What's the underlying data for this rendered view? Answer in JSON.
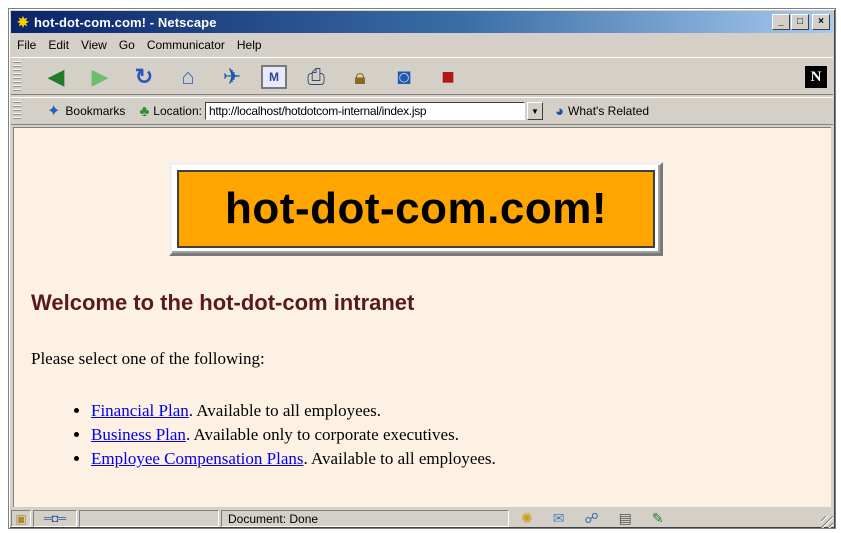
{
  "window": {
    "title": "hot-dot-com.com! - Netscape",
    "icon": "netscape-app-icon",
    "controls": [
      "_",
      "□",
      "×"
    ]
  },
  "menubar": {
    "items": [
      "File",
      "Edit",
      "View",
      "Go",
      "Communicator",
      "Help"
    ]
  },
  "nav_toolbar": {
    "buttons": [
      {
        "name": "back",
        "icon": "back-arrow-icon"
      },
      {
        "name": "forward",
        "icon": "forward-arrow-icon"
      },
      {
        "name": "reload",
        "icon": "reload-icon"
      },
      {
        "name": "home",
        "icon": "home-icon"
      },
      {
        "name": "search",
        "icon": "search-icon"
      },
      {
        "name": "netscape-guide",
        "icon": "guide-icon"
      },
      {
        "name": "print",
        "icon": "print-icon"
      },
      {
        "name": "security",
        "icon": "lock-icon"
      },
      {
        "name": "shop",
        "icon": "shopping-bag-icon"
      },
      {
        "name": "stop",
        "icon": "stop-icon"
      }
    ],
    "logo": "N"
  },
  "location_toolbar": {
    "bookmarks_label": "Bookmarks",
    "location_label": "Location:",
    "url": "http://localhost/hotdotcom-internal/index.jsp",
    "related_label": "What's Related"
  },
  "page": {
    "banner_text": "hot-dot-com.com!",
    "heading": "Welcome to the hot-dot-com intranet",
    "prompt": "Please select one of the following:",
    "options": [
      {
        "link": "Financial Plan",
        "note": ". Available to all employees."
      },
      {
        "link": "Business Plan",
        "note": ". Available only to corporate executives."
      },
      {
        "link": "Employee Compensation Plans",
        "note": ". Available to all employees."
      }
    ]
  },
  "statusbar": {
    "status_text": "Document: Done"
  },
  "colors": {
    "page_background": "#fcf1e3",
    "banner_orange": "#ffa500",
    "heading_maroon": "#5a1a1a",
    "link_blue": "#0000ee",
    "title_gradient_start": "#0a246a"
  }
}
